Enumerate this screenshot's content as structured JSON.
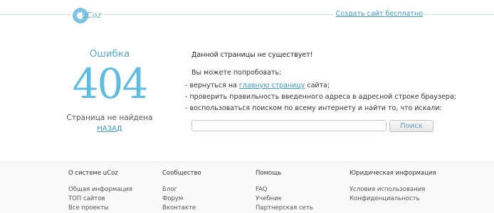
{
  "header": {
    "logo_text": "uCoz",
    "create_site_link": "Создать сайт бесплатно",
    "arrow": "→"
  },
  "error": {
    "title": "Ошибка",
    "code": "404",
    "subtitle": "Страница не найдена",
    "back_link": "НАЗАД"
  },
  "message": {
    "main": "Данной страницы не существует!",
    "try_text": "Вы можете попробовать:",
    "items": {
      "return_prefix": "- вернуться на ",
      "home_link": "главную страницу",
      "return_suffix": " сайта;",
      "check_address": "- проверить правильность введенного адреса в адресной строке браузера;",
      "use_search": "- воспользоваться поиском по всему интернету и найти то, что искали:"
    }
  },
  "search": {
    "value": "",
    "button_label": "Поиск"
  },
  "footer": {
    "columns": [
      {
        "title": "О системе uCoz",
        "links": [
          "Общая информация",
          "ТОП сайтов",
          "Все проекты"
        ]
      },
      {
        "title": "Сообщество",
        "links": [
          "Блог",
          "Форум",
          "Вконтакте"
        ]
      },
      {
        "title": "Помощь",
        "links": [
          "FAQ",
          "Учебник",
          "Партнерская сеть"
        ]
      },
      {
        "title": "Юридическая информация",
        "links": [
          "Условия использования",
          "Конфиденциальность"
        ]
      }
    ]
  }
}
